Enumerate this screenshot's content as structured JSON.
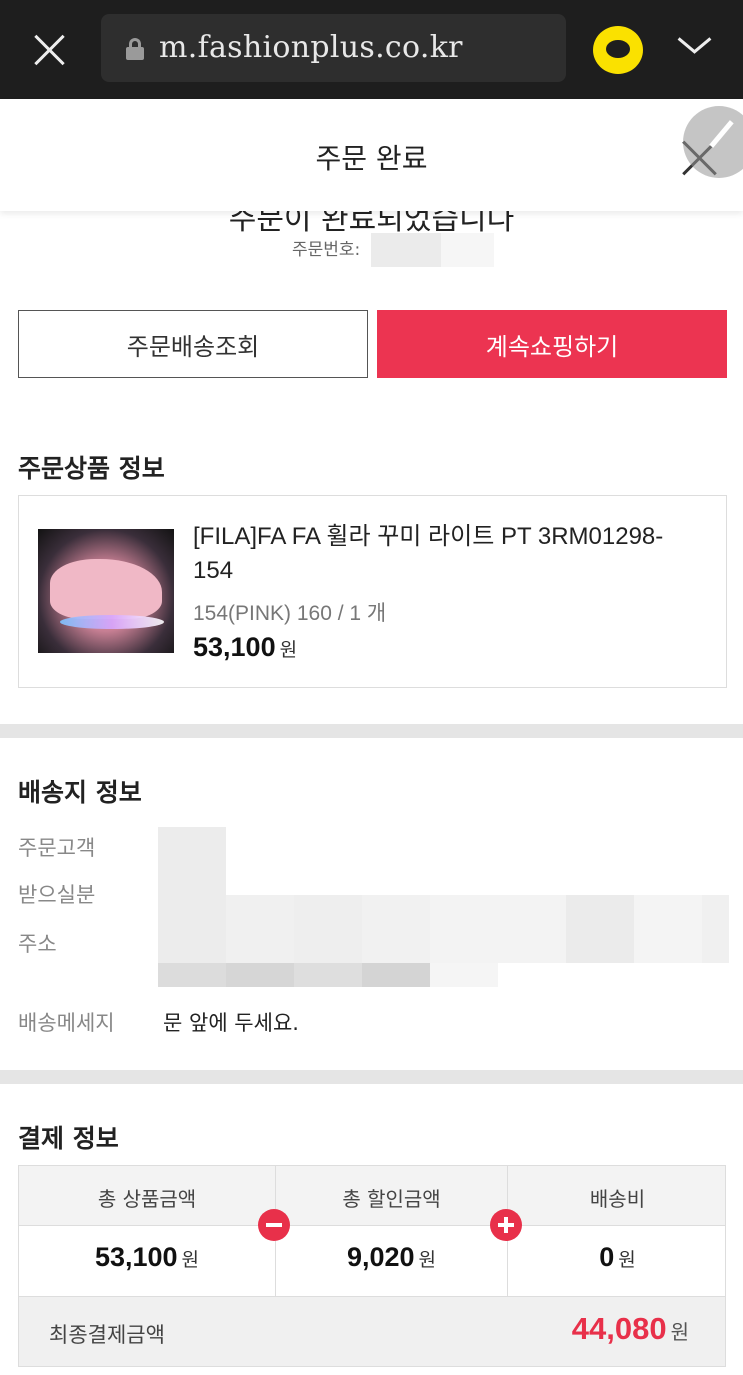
{
  "browser": {
    "url": "m.fashionplus.co.kr",
    "close_icon": "close-icon",
    "lock_icon": "lock-icon",
    "kakao_icon": "kakao-talk-icon",
    "menu_icon": "chevron-down-icon"
  },
  "header": {
    "title": "주문 완료",
    "close_icon": "close-icon",
    "edit_icon": "pencil-icon"
  },
  "order": {
    "complete_message": "주문이 완료되었습니다",
    "order_no_label": "주문번호:"
  },
  "actions": {
    "track_label": "주문배송조회",
    "continue_label": "계속쇼핑하기"
  },
  "product_section": {
    "title": "주문상품 정보",
    "name": "[FILA]FA FA 휠라 꾸미 라이트 PT 3RM01298-154",
    "option": "154(PINK) 160 / 1 개",
    "price": "53,100",
    "currency": "원"
  },
  "shipping": {
    "title": "배송지 정보",
    "customer_label": "주문고객",
    "recipient_label": "받으실분",
    "address_label": "주소",
    "message_label": "배송메세지",
    "message_value": "문 앞에 두세요."
  },
  "payment": {
    "title": "결제 정보",
    "total_label": "총 상품금액",
    "total_value": "53,100",
    "discount_label": "총 할인금액",
    "discount_value": "9,020",
    "shipping_label": "배송비",
    "shipping_value": "0",
    "currency": "원",
    "final_label": "최종결제금액",
    "final_value": "44,080"
  },
  "colors": {
    "accent": "#ec3451",
    "price_highlight": "#e8304a",
    "browser_bar": "#1e1e1e",
    "kakao_yellow": "#fae100"
  }
}
